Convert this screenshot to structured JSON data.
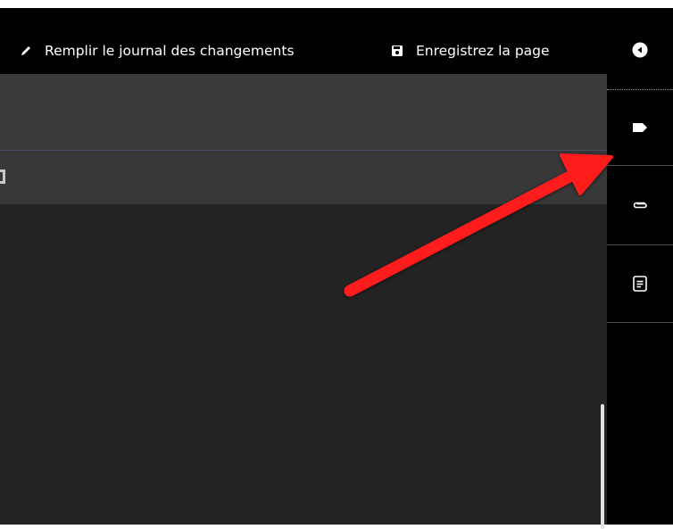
{
  "toolbar": {
    "changelog_label": "Remplir le journal des changements",
    "changelog_icon": "pencil-icon",
    "save_label": "Enregistrez la page",
    "save_icon": "floppy-disk-icon"
  },
  "sidebar": {
    "items": [
      {
        "icon": "collapse-left-icon"
      },
      {
        "icon": "tag-icon"
      },
      {
        "icon": "paperclip-icon"
      },
      {
        "icon": "document-icon"
      }
    ]
  },
  "colors": {
    "toolbar_bg": "#000000",
    "header_bg": "#3a3a3a",
    "editor_bg": "#232323",
    "annotation_arrow": "#ff1a1a",
    "text": "#ffffff"
  }
}
